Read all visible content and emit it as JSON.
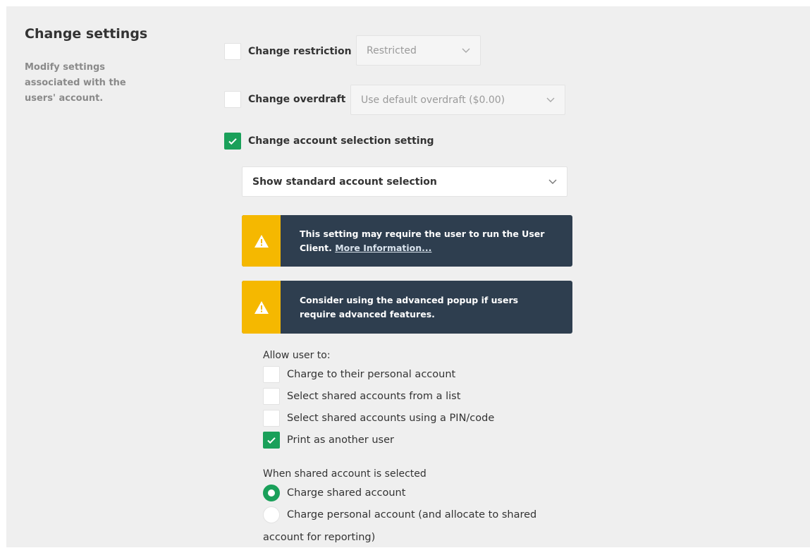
{
  "section": {
    "title": "Change settings",
    "description": "Modify settings associated with the users' account."
  },
  "restriction": {
    "label": "Change restriction",
    "checked": false,
    "select_value": "Restricted"
  },
  "overdraft": {
    "label": "Change overdraft",
    "checked": false,
    "select_value": "Use default overdraft ($0.00)"
  },
  "account_selection": {
    "label": "Change account selection setting",
    "checked": true,
    "select_value": "Show standard account selection"
  },
  "alerts": [
    {
      "text": "This setting may require the user to run the User Client.",
      "link": "More Information..."
    },
    {
      "text": "Consider using the advanced popup if users require advanced features.",
      "link": ""
    }
  ],
  "allow": {
    "heading": "Allow user to:",
    "options": [
      {
        "label": "Charge to their personal account",
        "checked": false
      },
      {
        "label": "Select shared accounts from a list",
        "checked": false
      },
      {
        "label": "Select shared accounts using a PIN/code",
        "checked": false
      },
      {
        "label": "Print as another user",
        "checked": true
      }
    ]
  },
  "shared": {
    "heading": "When shared account is selected",
    "options": [
      {
        "label": "Charge shared account",
        "selected": true
      },
      {
        "label": "Charge personal account (and allocate to shared",
        "label_cont": "account for reporting)",
        "selected": false
      }
    ]
  },
  "colors": {
    "accent": "#1aa05a",
    "warning": "#f5b800",
    "alert_bg": "#2e3e4f",
    "panel_bg": "#efefef"
  }
}
